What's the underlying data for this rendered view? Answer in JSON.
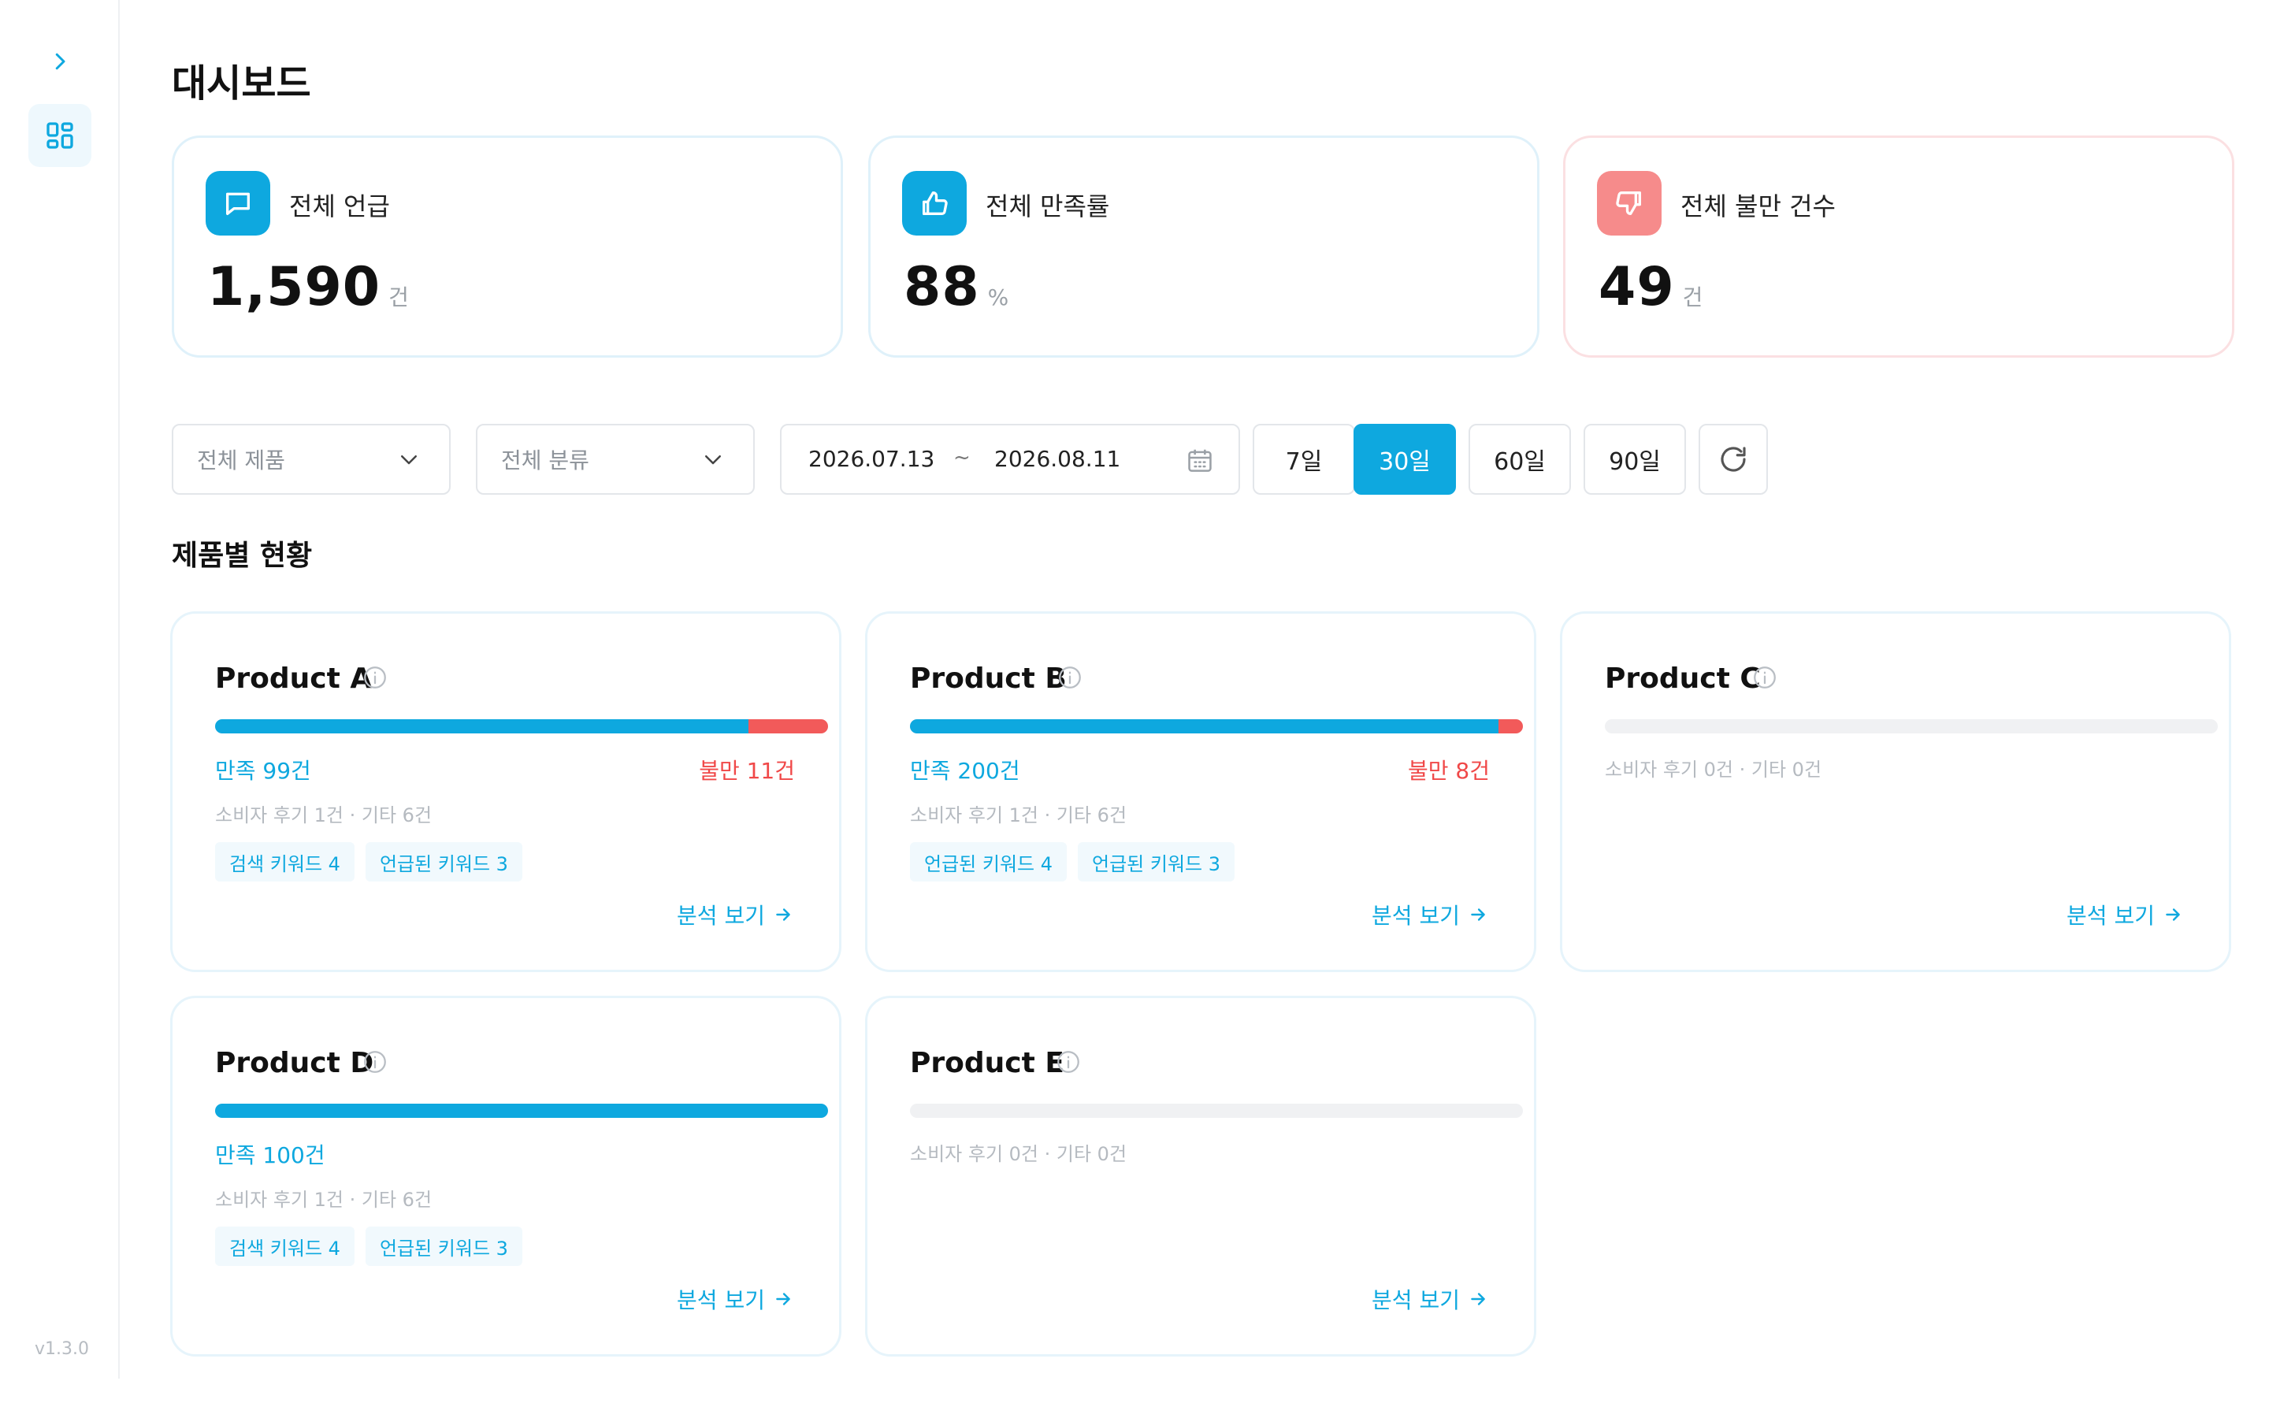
{
  "sidebar": {
    "version": "v1.3.0"
  },
  "page": {
    "title": "대시보드"
  },
  "stats": [
    {
      "label": "전체 언급",
      "value": "1,590",
      "unit": "건",
      "icon": "chat-bubble-icon",
      "color": "#0ea8df"
    },
    {
      "label": "전체 만족률",
      "value": "88",
      "unit": "%",
      "icon": "thumbs-up-icon",
      "color": "#0ea8df"
    },
    {
      "label": "전체 불만 건수",
      "value": "49",
      "unit": "건",
      "icon": "thumbs-down-icon",
      "color": "#f68b8b"
    }
  ],
  "filters": {
    "product_select": "전체 제품",
    "category_select": "전체 분류",
    "date_start": "2026.07.13",
    "date_sep": "~",
    "date_end": "2026.08.11",
    "periods": [
      "7일",
      "30일",
      "60일",
      "90일"
    ],
    "active_period": "30일"
  },
  "section": {
    "title": "제품별 현황"
  },
  "products": [
    {
      "name": "Product A",
      "satisfied": "만족 99건",
      "dissatisfied": "불만 11건",
      "sat_ratio": 0.87,
      "dis_ratio": 0.13,
      "meta": "소비자 후기 1건 · 기타 6건",
      "keywords": [
        "검색 키워드 4",
        "언급된 키워드 3"
      ],
      "action": "분석 보기"
    },
    {
      "name": "Product B",
      "satisfied": "만족 200건",
      "dissatisfied": "불만 8건",
      "sat_ratio": 0.96,
      "dis_ratio": 0.04,
      "meta": "소비자 후기 1건 · 기타 6건",
      "keywords": [
        "언급된 키워드 4",
        "언급된 키워드 3"
      ],
      "action": "분석 보기"
    },
    {
      "name": "Product C",
      "satisfied": "",
      "dissatisfied": "",
      "sat_ratio": 0,
      "dis_ratio": 0,
      "meta": "소비자 후기 0건 · 기타 0건",
      "keywords": [],
      "action": "분석 보기"
    },
    {
      "name": "Product D",
      "satisfied": "만족 100건",
      "dissatisfied": "",
      "sat_ratio": 1.0,
      "dis_ratio": 0,
      "meta": "소비자 후기 1건 · 기타 6건",
      "keywords": [
        "검색 키워드 4",
        "언급된 키워드 3"
      ],
      "action": "분석 보기"
    },
    {
      "name": "Product E",
      "satisfied": "",
      "dissatisfied": "",
      "sat_ratio": 0,
      "dis_ratio": 0,
      "meta": "소비자 후기 0건 · 기타 0건",
      "keywords": [],
      "action": "분석 보기"
    }
  ],
  "colors": {
    "accent": "#0ea8df",
    "negative": "#f25a5a"
  }
}
